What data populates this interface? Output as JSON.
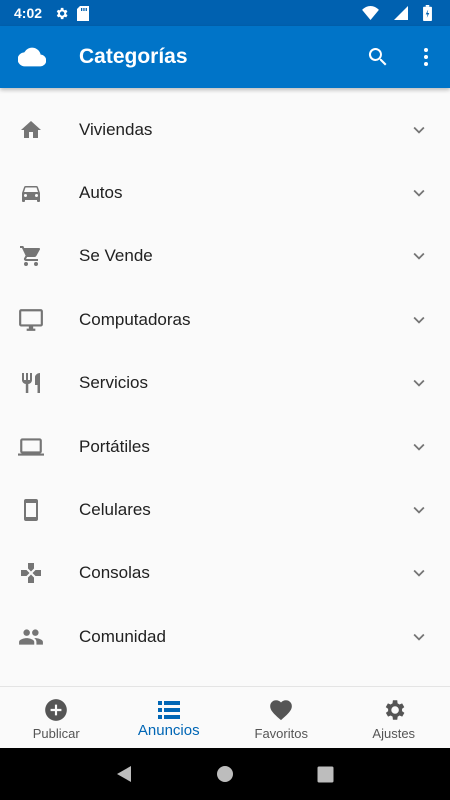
{
  "status_bar": {
    "time": "4:02",
    "left_icons": [
      "gear-icon",
      "sd-card-icon"
    ],
    "right_icons": [
      "wifi-icon",
      "signal-icon",
      "battery-icon"
    ]
  },
  "app_bar": {
    "title": "Categorías",
    "logo_icon": "cloud-icon",
    "actions": [
      "search-icon",
      "more-vert-icon"
    ]
  },
  "categories": [
    {
      "label": "Viviendas",
      "icon": "home-icon"
    },
    {
      "label": "Autos",
      "icon": "car-icon"
    },
    {
      "label": "Se Vende",
      "icon": "cart-icon"
    },
    {
      "label": "Computadoras",
      "icon": "desktop-icon"
    },
    {
      "label": "Servicios",
      "icon": "restaurant-icon"
    },
    {
      "label": "Portátiles",
      "icon": "laptop-icon"
    },
    {
      "label": "Celulares",
      "icon": "smartphone-icon"
    },
    {
      "label": "Consolas",
      "icon": "gamepad-icon"
    },
    {
      "label": "Comunidad",
      "icon": "people-icon"
    }
  ],
  "bottom_nav": {
    "items": [
      {
        "label": "Publicar",
        "icon": "add-circle-icon"
      },
      {
        "label": "Anuncios",
        "icon": "list-icon",
        "active": true
      },
      {
        "label": "Favoritos",
        "icon": "heart-icon"
      },
      {
        "label": "Ajustes",
        "icon": "settings-icon"
      }
    ]
  },
  "colors": {
    "status_bar": "#0061b0",
    "app_bar": "#0074c8",
    "active_nav": "#0066b5",
    "icon_gray": "#757575",
    "background": "#fafafa"
  }
}
